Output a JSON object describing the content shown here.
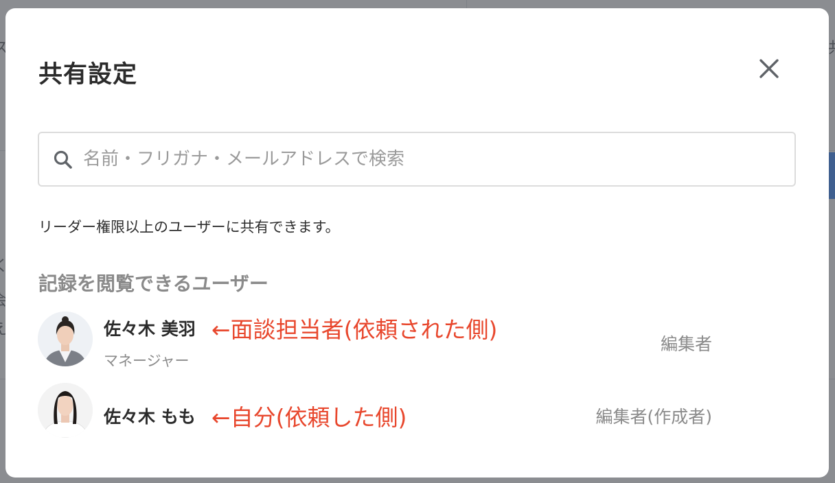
{
  "background": {
    "fragments": [
      "く",
      "ス",
      "や",
      "会",
      "え",
      "共"
    ]
  },
  "modal": {
    "title": "共有設定",
    "close_icon": "close-icon",
    "search": {
      "icon": "search-icon",
      "placeholder": "名前・フリガナ・メールアドレスで検索",
      "value": ""
    },
    "notice": "リーダー権限以上のユーザーに共有できます。",
    "section_title": "記録を閲覧できるユーザー",
    "users": [
      {
        "name": "佐々木 美羽",
        "subtitle": "マネージャー",
        "annotation": "←面談担当者(依頼された側)",
        "permission": "編集者"
      },
      {
        "name": "佐々木 もも",
        "subtitle": "",
        "annotation": "←自分(依頼した側)",
        "permission": "編集者(作成者)"
      }
    ]
  },
  "colors": {
    "overlay": "#8b8d91",
    "annotation": "#e8472d",
    "title": "#2b2b2b",
    "muted": "#8a8a8a"
  }
}
